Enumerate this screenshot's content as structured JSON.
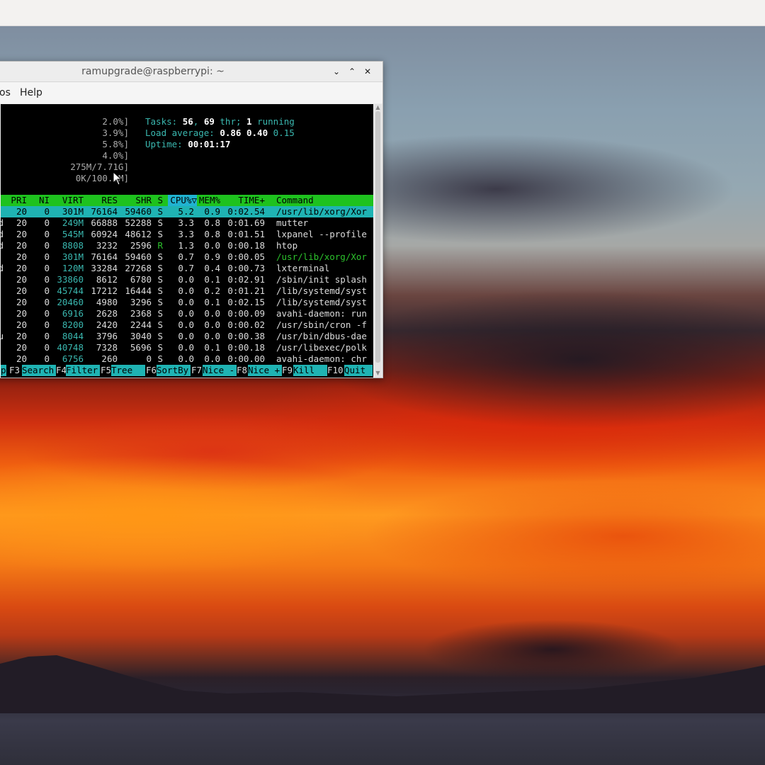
{
  "window": {
    "title": "ramupgrade@raspberrypi: ~"
  },
  "menubar": {
    "items": [
      "os",
      "Help"
    ]
  },
  "meters": [
    "2.0%]",
    "3.9%]",
    "5.8%]",
    "4.0%]",
    "275M/7.71G]",
    "0K/100.0M]"
  ],
  "summary": {
    "tasks_label": "Tasks: ",
    "tasks": "56",
    "sep": ", ",
    "threads": "69",
    "thr_label": " thr; ",
    "running": "1",
    "running_label": " running",
    "load_label": "Load average: ",
    "load1": "0.86",
    "load5": "0.40",
    "load15": "0.15",
    "uptime_label": "Uptime: ",
    "uptime": "00:01:17"
  },
  "table": {
    "headers": {
      "pri": "PRI",
      "ni": "NI",
      "virt": "VIRT",
      "res": "RES",
      "shr": "SHR",
      "s": "S",
      "cpu": "CPU%▽",
      "mem": "MEM%",
      "time": "TIME+",
      "cmd": "Command"
    },
    "rows": [
      {
        "u": "",
        "pri": "20",
        "ni": "0",
        "virt": "301M",
        "res": "76164",
        "shr": "59460",
        "s": "S",
        "cpu": "5.2",
        "mem": "0.9",
        "time": "0:02.54",
        "cmd": "/usr/lib/xorg/Xor"
      },
      {
        "u": "d",
        "pri": "20",
        "ni": "0",
        "virt": "249M",
        "res": "66888",
        "shr": "52288",
        "s": "S",
        "cpu": "3.3",
        "mem": "0.8",
        "time": "0:01.69",
        "cmd": "mutter"
      },
      {
        "u": "d",
        "pri": "20",
        "ni": "0",
        "virt": "545M",
        "res": "60924",
        "shr": "48612",
        "s": "S",
        "cpu": "3.3",
        "mem": "0.8",
        "time": "0:01.51",
        "cmd": "lxpanel --profile"
      },
      {
        "u": "d",
        "pri": "20",
        "ni": "0",
        "virt": "8808",
        "res": "3232",
        "shr": "2596",
        "s": "R",
        "cpu": "1.3",
        "mem": "0.0",
        "time": "0:00.18",
        "cmd": "htop"
      },
      {
        "u": "",
        "pri": "20",
        "ni": "0",
        "virt": "301M",
        "res": "76164",
        "shr": "59460",
        "s": "S",
        "cpu": "0.7",
        "mem": "0.9",
        "time": "0:00.05",
        "cmd": "/usr/lib/xorg/Xor"
      },
      {
        "u": "d",
        "pri": "20",
        "ni": "0",
        "virt": "120M",
        "res": "33284",
        "shr": "27268",
        "s": "S",
        "cpu": "0.7",
        "mem": "0.4",
        "time": "0:00.73",
        "cmd": "lxterminal"
      },
      {
        "u": "",
        "pri": "20",
        "ni": "0",
        "virt": "33860",
        "res": "8612",
        "shr": "6780",
        "s": "S",
        "cpu": "0.0",
        "mem": "0.1",
        "time": "0:02.91",
        "cmd": "/sbin/init splash"
      },
      {
        "u": "",
        "pri": "20",
        "ni": "0",
        "virt": "45744",
        "res": "17212",
        "shr": "16444",
        "s": "S",
        "cpu": "0.0",
        "mem": "0.2",
        "time": "0:01.21",
        "cmd": "/lib/systemd/syst"
      },
      {
        "u": "",
        "pri": "20",
        "ni": "0",
        "virt": "20460",
        "res": "4980",
        "shr": "3296",
        "s": "S",
        "cpu": "0.0",
        "mem": "0.1",
        "time": "0:02.15",
        "cmd": "/lib/systemd/syst"
      },
      {
        "u": "",
        "pri": "20",
        "ni": "0",
        "virt": "6916",
        "res": "2628",
        "shr": "2368",
        "s": "S",
        "cpu": "0.0",
        "mem": "0.0",
        "time": "0:00.09",
        "cmd": "avahi-daemon: run"
      },
      {
        "u": "",
        "pri": "20",
        "ni": "0",
        "virt": "8200",
        "res": "2420",
        "shr": "2244",
        "s": "S",
        "cpu": "0.0",
        "mem": "0.0",
        "time": "0:00.02",
        "cmd": "/usr/sbin/cron -f"
      },
      {
        "u": "u",
        "pri": "20",
        "ni": "0",
        "virt": "8044",
        "res": "3796",
        "shr": "3040",
        "s": "S",
        "cpu": "0.0",
        "mem": "0.0",
        "time": "0:00.38",
        "cmd": "/usr/bin/dbus-dae"
      },
      {
        "u": "",
        "pri": "20",
        "ni": "0",
        "virt": "40748",
        "res": "7328",
        "shr": "5696",
        "s": "S",
        "cpu": "0.0",
        "mem": "0.1",
        "time": "0:00.18",
        "cmd": "/usr/libexec/polk"
      },
      {
        "u": "",
        "pri": "20",
        "ni": "0",
        "virt": "6756",
        "res": "260",
        "shr": "0",
        "s": "S",
        "cpu": "0.0",
        "mem": "0.0",
        "time": "0:00.00",
        "cmd": "avahi-daemon: chr"
      }
    ]
  },
  "footer": [
    {
      "key": "",
      "label": "p"
    },
    {
      "key": "F3",
      "label": "Search"
    },
    {
      "key": "F4",
      "label": "Filter"
    },
    {
      "key": "F5",
      "label": "Tree  "
    },
    {
      "key": "F6",
      "label": "SortBy"
    },
    {
      "key": "F7",
      "label": "Nice -"
    },
    {
      "key": "F8",
      "label": "Nice +"
    },
    {
      "key": "F9",
      "label": "Kill  "
    },
    {
      "key": "F10",
      "label": "Quit  "
    }
  ]
}
